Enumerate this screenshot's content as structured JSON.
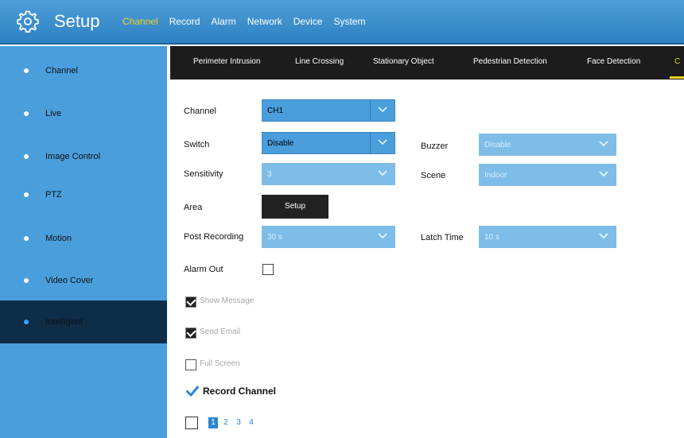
{
  "header": {
    "title": "Setup",
    "nav": [
      "Channel",
      "Record",
      "Alarm",
      "Network",
      "Device",
      "System"
    ],
    "active_nav": "Channel"
  },
  "sidebar": {
    "items": [
      {
        "label": "Channel"
      },
      {
        "label": "Live"
      },
      {
        "label": "Image Control"
      },
      {
        "label": "PTZ"
      },
      {
        "label": "Motion"
      },
      {
        "label": "Video Cover"
      },
      {
        "label": "Intelligent"
      }
    ],
    "active": "Intelligent"
  },
  "subtabs": {
    "items": [
      "Perimeter Intrusion",
      "Line Crossing",
      "Stationary Object",
      "Pedestrian Detection",
      "Face Detection",
      "C"
    ],
    "active": "C"
  },
  "form": {
    "channel": {
      "label": "Channel",
      "value": "CH1"
    },
    "switch": {
      "label": "Switch",
      "value": "Disable"
    },
    "buzzer": {
      "label": "Buzzer",
      "value": "Disable"
    },
    "sensitivity": {
      "label": "Sensitivity",
      "value": "3"
    },
    "scene": {
      "label": "Scene",
      "value": "Indoor"
    },
    "area": {
      "label": "Area",
      "button": "Setup"
    },
    "post_recording": {
      "label": "Post Recording",
      "value": "30 s"
    },
    "latch_time": {
      "label": "Latch Time",
      "value": "10 s"
    },
    "alarm_out": {
      "label": "Alarm Out",
      "checked": false
    },
    "show_message": {
      "label": "Show Message",
      "checked": true
    },
    "send_email": {
      "label": "Send Email",
      "checked": true
    },
    "full_screen": {
      "label": "Full Screen",
      "checked": false
    },
    "record_channel": {
      "label": "Record Channel",
      "checked": true
    },
    "channels": [
      "1",
      "2",
      "3",
      "4"
    ],
    "selected_channel": "1"
  },
  "colors": {
    "accent_blue": "#4a9edc",
    "active_yellow": "#f2d21e",
    "sidebar_active": "#0e2d49"
  }
}
